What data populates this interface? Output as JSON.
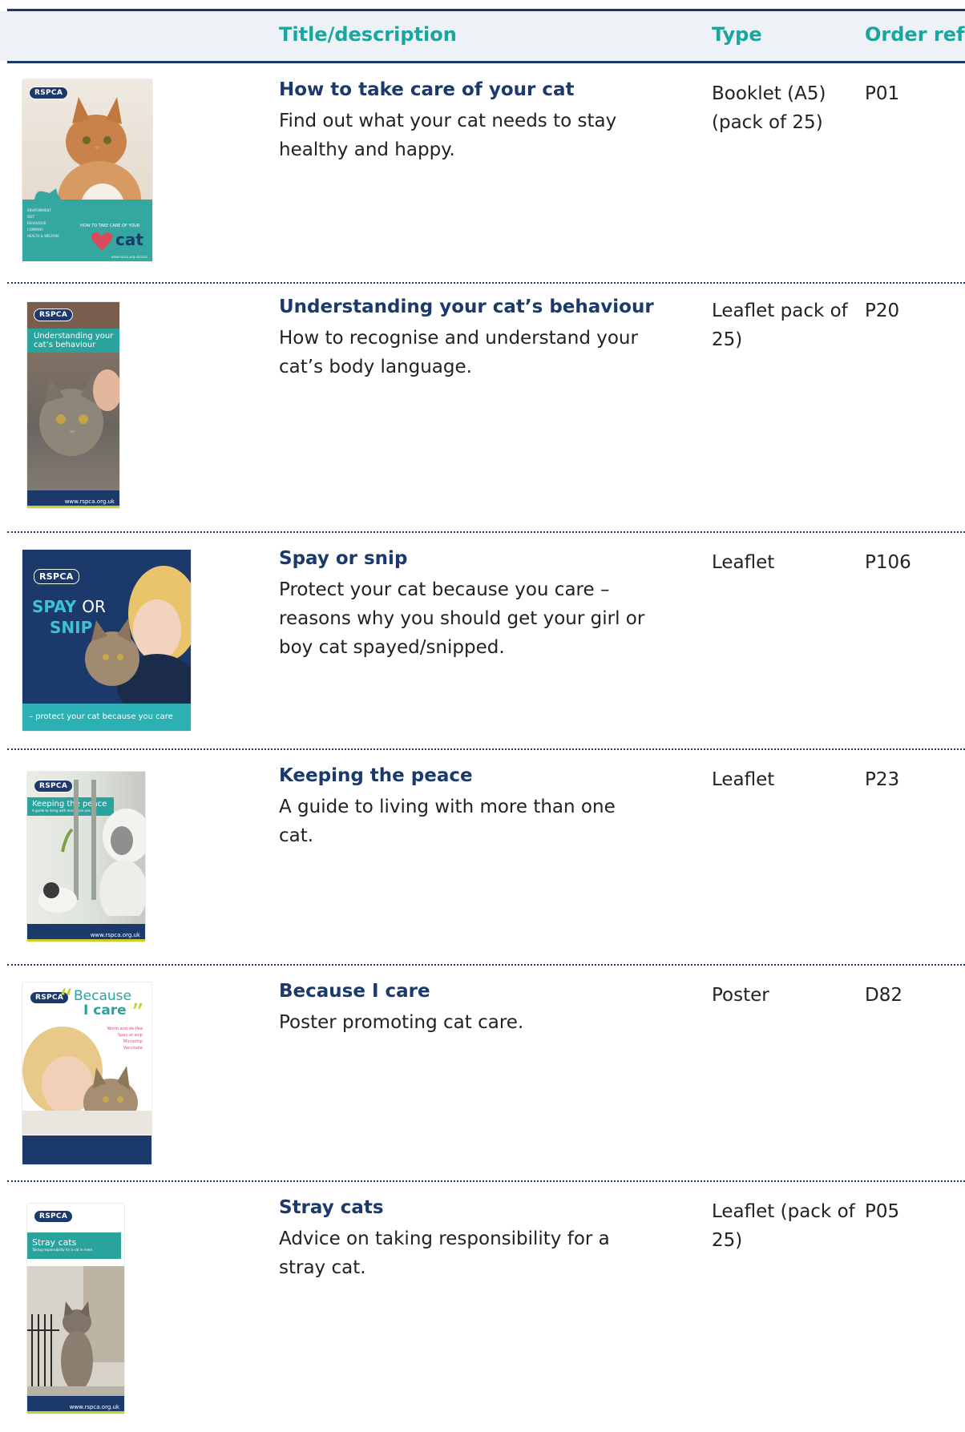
{
  "header": {
    "col_title": "Title/description",
    "col_type": "Type",
    "col_ref": "Order ref"
  },
  "rows": [
    {
      "title": "How to take care of your cat",
      "description": "Find out what your cat needs to stay healthy and happy.",
      "type": "Booklet (A5) (pack of 25)",
      "ref": "P01",
      "cover": {
        "logo": "RSPCA",
        "heading": "HOW TO TAKE CARE OF YOUR",
        "big": "cat",
        "items": [
          "ENVIRONMENT",
          "DIET",
          "BEHAVIOUR",
          "COMPANY",
          "HEALTH & WELFARE"
        ],
        "site": "www.rspca.org.uk/cats"
      }
    },
    {
      "title": "Understanding your cat’s behaviour",
      "description": "How to recognise and understand your cat’s body language.",
      "type": "Leaflet pack of 25)",
      "ref": "P20",
      "cover": {
        "logo": "RSPCA",
        "heading": "Understanding your cat’s behaviour",
        "site": "www.rspca.org.uk"
      }
    },
    {
      "title": "Spay or snip",
      "description": "Protect your cat because you care – reasons why you should get your girl or boy cat spayed/snipped.",
      "type": "Leaflet",
      "ref": "P106",
      "cover": {
        "logo": "RSPCA",
        "word1": "SPAY",
        "word2": "OR",
        "word3": "SNIP",
        "tagline": "– protect your cat because you care"
      }
    },
    {
      "title": "Keeping the peace",
      "description": "A guide to living with more than one cat.",
      "type": "Leaflet",
      "ref": "P23",
      "cover": {
        "logo": "RSPCA",
        "heading": "Keeping the peace",
        "sub": "A guide to living with more than one cat",
        "site": "www.rspca.org.uk"
      }
    },
    {
      "title": "Because I care",
      "description": "Poster promoting cat care.",
      "type": "Poster",
      "ref": "D82",
      "cover": {
        "logo": "RSPCA",
        "line1": "Because",
        "line2": "I care",
        "items": [
          "Worm and de-flea",
          "Spay or snip",
          "Microchip",
          "Vaccinate"
        ]
      }
    },
    {
      "title": "Stray cats",
      "description": "Advice on taking responsibility for a stray cat.",
      "type": "Leaflet (pack of 25)",
      "ref": "P05",
      "cover": {
        "logo": "RSPCA",
        "heading": "Stray cats",
        "sub": "Taking responsibility for a cat in need",
        "site": "www.rspca.org.uk"
      }
    }
  ],
  "colors": {
    "navy": "#1b3a6b",
    "teal": "#1aa6a0",
    "header_bg": "#eef1f6"
  }
}
